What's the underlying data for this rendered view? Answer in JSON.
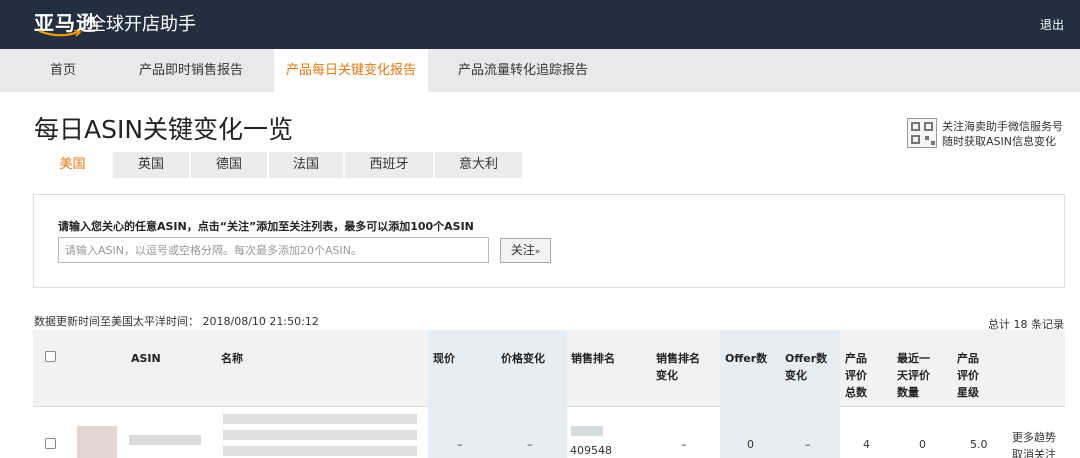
{
  "header": {
    "logo": "亚马逊",
    "app_name": "全球开店助手",
    "logout": "退出"
  },
  "nav": {
    "items": [
      "首页",
      "产品即时销售报告",
      "产品每日关键变化报告",
      "产品流量转化追踪报告"
    ],
    "active": 2
  },
  "page": {
    "title": "每日ASIN关键变化一览",
    "wechat_line1": "关注海卖助手微信服务号",
    "wechat_line2": "随时获取ASIN信息变化"
  },
  "countries": {
    "items": [
      "美国",
      "英国",
      "德国",
      "法国",
      "西班牙",
      "意大利"
    ],
    "active": 0
  },
  "search": {
    "hint": "请输入您关心的任意ASIN，点击“关注”添加至关注列表，最多可以添加100个ASIN",
    "placeholder": "请输入ASIN，以逗号或空格分隔。每次最多添加20个ASIN。",
    "follow_label": "关注",
    "follow_chevron": "»"
  },
  "meta": {
    "update_time": "数据更新时间至美国太平洋时间：  2018/08/10 21:50:12",
    "total": "总计  18  条记录"
  },
  "table": {
    "headers": {
      "asin": "ASIN",
      "name": "名称",
      "price": "现价",
      "price_change": "价格变化",
      "sales_rank": "销售排名",
      "sales_rank_change_1": "销售排名",
      "sales_rank_change_2": "变化",
      "offer": "Offer数",
      "offer_change_1": "Offer数",
      "offer_change_2": "变化",
      "reviews_1": "产品",
      "reviews_2": "评价",
      "reviews_3": "总数",
      "recent_1": "最近一",
      "recent_2": "天评价",
      "recent_3": "数量",
      "stars_1": "产品",
      "stars_2": "评价",
      "stars_3": "星级"
    },
    "rows": [
      {
        "price": "–",
        "price_change": "–",
        "sales_rank": "409548",
        "sales_rank_change": "–",
        "offer": "0",
        "offer_change": "–",
        "reviews": "4",
        "recent": "0",
        "stars": "5.0",
        "action_1": "更多趋势",
        "action_2": "取消关注"
      }
    ]
  },
  "colors": {
    "topbar": "#232f3e",
    "accent": "#e47911",
    "highlight_column": "#e6eef3"
  }
}
